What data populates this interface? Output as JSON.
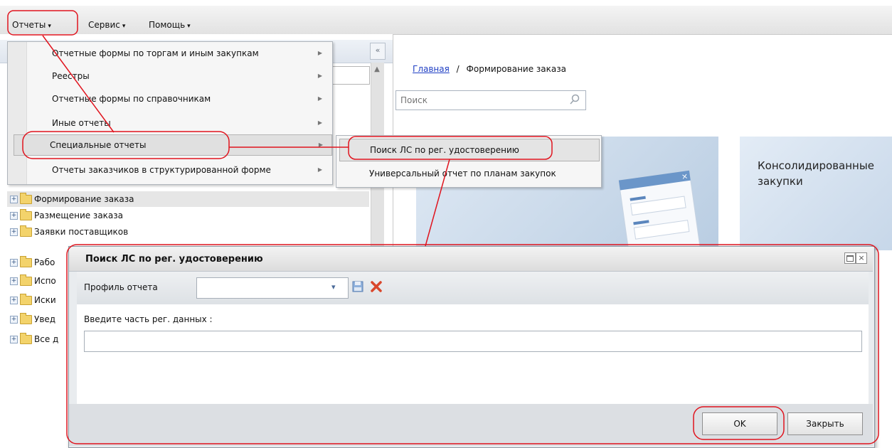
{
  "menubar": {
    "items": [
      {
        "label": "Отчеты",
        "caret": "▾"
      },
      {
        "label": "Сервис",
        "caret": "▾"
      },
      {
        "label": "Помощь",
        "caret": "▾"
      }
    ]
  },
  "reports_menu": {
    "items": [
      {
        "label": "Отчетные формы по торгам и иным закупкам"
      },
      {
        "label": "Реестры"
      },
      {
        "label": "Отчетные формы по справочникам"
      },
      {
        "label": "Иные отчеты"
      },
      {
        "label": "Специальные отчеты"
      },
      {
        "label": "Отчеты заказчиков в структурированной форме"
      }
    ],
    "submenu_arrow": "▶"
  },
  "special_reports_submenu": {
    "items": [
      {
        "label": "Поиск ЛС по рег. удостоверению"
      },
      {
        "label": "Универсальный отчет по планам закупок"
      }
    ]
  },
  "tree": {
    "items": [
      {
        "label": "Формирование заказа",
        "selected": true
      },
      {
        "label": "Размещение заказа"
      },
      {
        "label": "Заявки поставщиков"
      },
      {
        "label": "Рабо"
      },
      {
        "label": "Испо"
      },
      {
        "label": "Иски"
      },
      {
        "label": "Увед"
      },
      {
        "label": "Все д"
      }
    ],
    "expander": "+"
  },
  "left_panel": {
    "collapse_label": "«",
    "scroll_up": "▲"
  },
  "breadcrumb": {
    "home": "Главная",
    "separator": "/",
    "current": "Формирование заказа"
  },
  "search": {
    "placeholder": "Поиск"
  },
  "tiles": {
    "consolidated_title_line1": "Консолидированные",
    "consolidated_title_line2": "закупки"
  },
  "dialog": {
    "title": "Поиск ЛС по рег. удостоверению",
    "close_glyph": "×",
    "profile_label": "Профиль отчета",
    "profile_value": "",
    "profile_arrow": "▾",
    "input_label": "Введите часть рег. данных :",
    "input_value": "",
    "ok_label": "OK",
    "close_label": "Закрыть"
  },
  "colors": {
    "annotation": "#e0141e",
    "link": "#1f3fc4",
    "accent_blue": "#4a6a99",
    "delete_red": "#d9462b"
  }
}
